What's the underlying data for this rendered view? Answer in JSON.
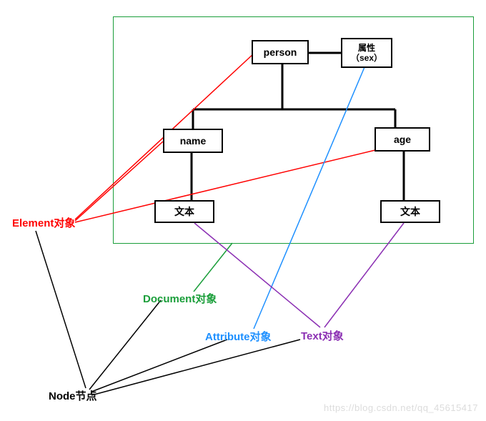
{
  "tree": {
    "root": "person",
    "attr": "属性\n（sex）",
    "name": "name",
    "age": "age",
    "text1": "文本",
    "text2": "文本"
  },
  "labels": {
    "element": "Element对象",
    "document": "Document对象",
    "attribute": "Attribute对象",
    "text": "Text对象",
    "node": "Node节点"
  },
  "colors": {
    "element": "#ff0000",
    "document": "#1a9e3a",
    "attribute": "#1e90ff",
    "text": "#8b2fb3",
    "node": "#000000",
    "box": "#000000"
  },
  "watermark": "https://blog.csdn.net/qq_45615417"
}
